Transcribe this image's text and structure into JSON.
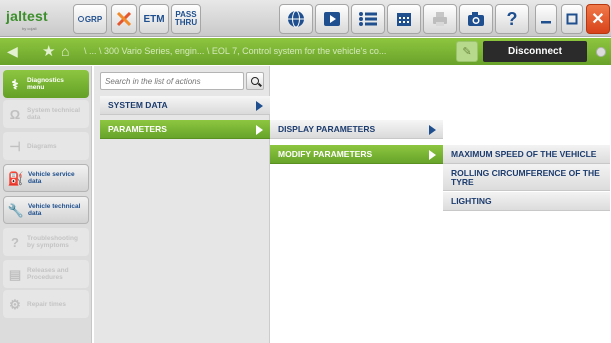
{
  "app": {
    "logo_text": "jaltest",
    "logo_sub": "by cojali"
  },
  "toolbar": {
    "grp_label": "GRP",
    "etm_label": "ETM",
    "pass_line1": "PASS",
    "pass_line2": "THRU",
    "help_label": "?",
    "minimize_label": "—",
    "maximize_label": "□",
    "close_label": "✕"
  },
  "nav": {
    "breadcrumb": "\\ ... \\ 300 Vario Series, engin... \\ EOL 7, Control system for the vehicle's co...",
    "disconnect_label": "Disconnect"
  },
  "sidebar": {
    "items": [
      {
        "label_1": "Diagnostics",
        "label_2": "menu",
        "icon": "stethoscope-icon",
        "state": "active"
      },
      {
        "label_1": "System technical",
        "label_2": "data",
        "icon": "omega-icon",
        "state": "disabled"
      },
      {
        "label_1": "Diagrams",
        "label_2": "",
        "icon": "diagram-icon",
        "state": "disabled"
      },
      {
        "label_1": "Vehicle service",
        "label_2": "data",
        "icon": "oil-can-icon",
        "state": "enabled"
      },
      {
        "label_1": "Vehicle technical",
        "label_2": "data",
        "icon": "wrench-icon",
        "state": "enabled"
      },
      {
        "label_1": "Troubleshooting",
        "label_2": "by symptoms",
        "icon": "troubleshoot-icon",
        "state": "disabled"
      },
      {
        "label_1": "Releases and",
        "label_2": "Procedures",
        "icon": "document-icon",
        "state": "disabled"
      },
      {
        "label_1": "Repair times",
        "label_2": "",
        "icon": "gears-icon",
        "state": "disabled"
      }
    ]
  },
  "actions": {
    "search_placeholder": "Search in the list of actions",
    "items": [
      "SYSTEM DATA",
      "PARAMETERS"
    ]
  },
  "submenu_parameters": [
    "DISPLAY PARAMETERS",
    "MODIFY PARAMETERS"
  ],
  "submenu_modify": [
    "MAXIMUM SPEED OF THE VEHICLE",
    "ROLLING CIRCUMFERENCE OF THE TYRE",
    "LIGHTING"
  ],
  "colors": {
    "accent_green": "#8ec63f",
    "nav_blue": "#1f4f8f",
    "disconnect_bg": "#2b2b2b",
    "close_red": "#d8421a"
  }
}
